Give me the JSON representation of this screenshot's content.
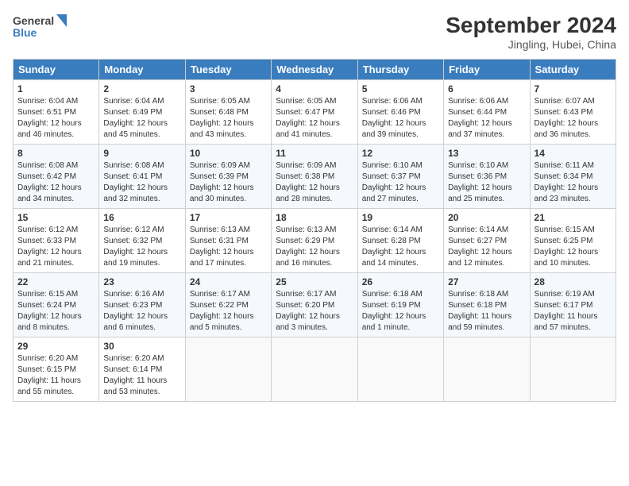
{
  "header": {
    "logo_line1": "General",
    "logo_line2": "Blue",
    "month": "September 2024",
    "location": "Jingling, Hubei, China"
  },
  "days_of_week": [
    "Sunday",
    "Monday",
    "Tuesday",
    "Wednesday",
    "Thursday",
    "Friday",
    "Saturday"
  ],
  "weeks": [
    [
      {
        "day": "1",
        "info": "Sunrise: 6:04 AM\nSunset: 6:51 PM\nDaylight: 12 hours\nand 46 minutes."
      },
      {
        "day": "2",
        "info": "Sunrise: 6:04 AM\nSunset: 6:49 PM\nDaylight: 12 hours\nand 45 minutes."
      },
      {
        "day": "3",
        "info": "Sunrise: 6:05 AM\nSunset: 6:48 PM\nDaylight: 12 hours\nand 43 minutes."
      },
      {
        "day": "4",
        "info": "Sunrise: 6:05 AM\nSunset: 6:47 PM\nDaylight: 12 hours\nand 41 minutes."
      },
      {
        "day": "5",
        "info": "Sunrise: 6:06 AM\nSunset: 6:46 PM\nDaylight: 12 hours\nand 39 minutes."
      },
      {
        "day": "6",
        "info": "Sunrise: 6:06 AM\nSunset: 6:44 PM\nDaylight: 12 hours\nand 37 minutes."
      },
      {
        "day": "7",
        "info": "Sunrise: 6:07 AM\nSunset: 6:43 PM\nDaylight: 12 hours\nand 36 minutes."
      }
    ],
    [
      {
        "day": "8",
        "info": "Sunrise: 6:08 AM\nSunset: 6:42 PM\nDaylight: 12 hours\nand 34 minutes."
      },
      {
        "day": "9",
        "info": "Sunrise: 6:08 AM\nSunset: 6:41 PM\nDaylight: 12 hours\nand 32 minutes."
      },
      {
        "day": "10",
        "info": "Sunrise: 6:09 AM\nSunset: 6:39 PM\nDaylight: 12 hours\nand 30 minutes."
      },
      {
        "day": "11",
        "info": "Sunrise: 6:09 AM\nSunset: 6:38 PM\nDaylight: 12 hours\nand 28 minutes."
      },
      {
        "day": "12",
        "info": "Sunrise: 6:10 AM\nSunset: 6:37 PM\nDaylight: 12 hours\nand 27 minutes."
      },
      {
        "day": "13",
        "info": "Sunrise: 6:10 AM\nSunset: 6:36 PM\nDaylight: 12 hours\nand 25 minutes."
      },
      {
        "day": "14",
        "info": "Sunrise: 6:11 AM\nSunset: 6:34 PM\nDaylight: 12 hours\nand 23 minutes."
      }
    ],
    [
      {
        "day": "15",
        "info": "Sunrise: 6:12 AM\nSunset: 6:33 PM\nDaylight: 12 hours\nand 21 minutes."
      },
      {
        "day": "16",
        "info": "Sunrise: 6:12 AM\nSunset: 6:32 PM\nDaylight: 12 hours\nand 19 minutes."
      },
      {
        "day": "17",
        "info": "Sunrise: 6:13 AM\nSunset: 6:31 PM\nDaylight: 12 hours\nand 17 minutes."
      },
      {
        "day": "18",
        "info": "Sunrise: 6:13 AM\nSunset: 6:29 PM\nDaylight: 12 hours\nand 16 minutes."
      },
      {
        "day": "19",
        "info": "Sunrise: 6:14 AM\nSunset: 6:28 PM\nDaylight: 12 hours\nand 14 minutes."
      },
      {
        "day": "20",
        "info": "Sunrise: 6:14 AM\nSunset: 6:27 PM\nDaylight: 12 hours\nand 12 minutes."
      },
      {
        "day": "21",
        "info": "Sunrise: 6:15 AM\nSunset: 6:25 PM\nDaylight: 12 hours\nand 10 minutes."
      }
    ],
    [
      {
        "day": "22",
        "info": "Sunrise: 6:15 AM\nSunset: 6:24 PM\nDaylight: 12 hours\nand 8 minutes."
      },
      {
        "day": "23",
        "info": "Sunrise: 6:16 AM\nSunset: 6:23 PM\nDaylight: 12 hours\nand 6 minutes."
      },
      {
        "day": "24",
        "info": "Sunrise: 6:17 AM\nSunset: 6:22 PM\nDaylight: 12 hours\nand 5 minutes."
      },
      {
        "day": "25",
        "info": "Sunrise: 6:17 AM\nSunset: 6:20 PM\nDaylight: 12 hours\nand 3 minutes."
      },
      {
        "day": "26",
        "info": "Sunrise: 6:18 AM\nSunset: 6:19 PM\nDaylight: 12 hours\nand 1 minute."
      },
      {
        "day": "27",
        "info": "Sunrise: 6:18 AM\nSunset: 6:18 PM\nDaylight: 11 hours\nand 59 minutes."
      },
      {
        "day": "28",
        "info": "Sunrise: 6:19 AM\nSunset: 6:17 PM\nDaylight: 11 hours\nand 57 minutes."
      }
    ],
    [
      {
        "day": "29",
        "info": "Sunrise: 6:20 AM\nSunset: 6:15 PM\nDaylight: 11 hours\nand 55 minutes."
      },
      {
        "day": "30",
        "info": "Sunrise: 6:20 AM\nSunset: 6:14 PM\nDaylight: 11 hours\nand 53 minutes."
      },
      {
        "day": "",
        "info": ""
      },
      {
        "day": "",
        "info": ""
      },
      {
        "day": "",
        "info": ""
      },
      {
        "day": "",
        "info": ""
      },
      {
        "day": "",
        "info": ""
      }
    ]
  ]
}
